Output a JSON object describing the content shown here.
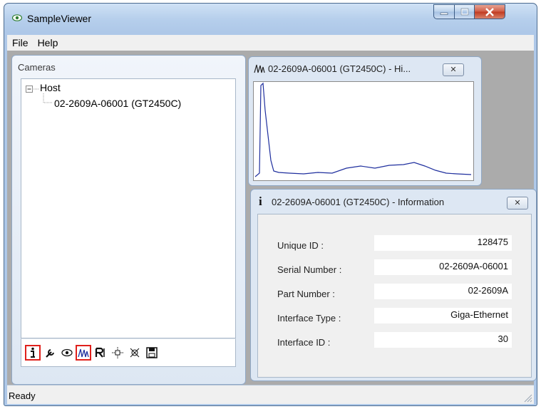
{
  "window": {
    "title": "SampleViewer"
  },
  "menu": {
    "items": [
      "File",
      "Help"
    ]
  },
  "cameras": {
    "title": "Cameras",
    "tree": {
      "root": "Host",
      "child": "02-2609A-06001 (GT2450C)"
    },
    "toolbar": [
      "info-icon",
      "wrench-icon",
      "eye-icon",
      "histogram-icon",
      "register-icon",
      "transfer-icon",
      "disconnect-icon",
      "save-icon"
    ]
  },
  "histogram": {
    "title": "02-2609A-06001 (GT2450C) - Hi...",
    "line_color": "#1f2f9e"
  },
  "information": {
    "title": "02-2609A-06001 (GT2450C) - Information",
    "rows": [
      {
        "label": "Unique ID :",
        "value": "128475"
      },
      {
        "label": "Serial Number :",
        "value": "02-2609A-06001"
      },
      {
        "label": "Part Number :",
        "value": "02-2609A"
      },
      {
        "label": "Interface Type :",
        "value": "Giga-Ethernet"
      },
      {
        "label": "Interface ID :",
        "value": "30"
      }
    ]
  },
  "status": {
    "text": "Ready"
  },
  "colors": {
    "accent_selected": "#e0201c",
    "titlebar": "#b6cfec"
  }
}
